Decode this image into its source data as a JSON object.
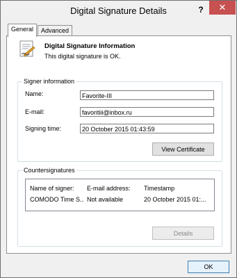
{
  "window": {
    "title": "Digital Signature Details",
    "help_label": "?",
    "close_label": "✕"
  },
  "tabs": [
    {
      "label": "General",
      "active": true
    },
    {
      "label": "Advanced",
      "active": false
    }
  ],
  "info": {
    "title": "Digital Signature Information",
    "status": "This digital signature is OK."
  },
  "signer": {
    "group_label": "Signer information",
    "name_label": "Name:",
    "name_value": "Favorite-III",
    "email_label": "E-mail:",
    "email_value": "favoritiii@inbox.ru",
    "time_label": "Signing time:",
    "time_value": "20 October  2015 01:43:59",
    "view_cert_label": "View Certificate"
  },
  "countersignatures": {
    "group_label": "Countersignatures",
    "columns": [
      "Name of signer:",
      "E-mail address:",
      "Timestamp"
    ],
    "rows": [
      [
        "COMODO Time S...",
        "Not available",
        "20 October 2015 01:..."
      ]
    ],
    "details_label": "Details"
  },
  "footer": {
    "ok_label": "OK"
  }
}
